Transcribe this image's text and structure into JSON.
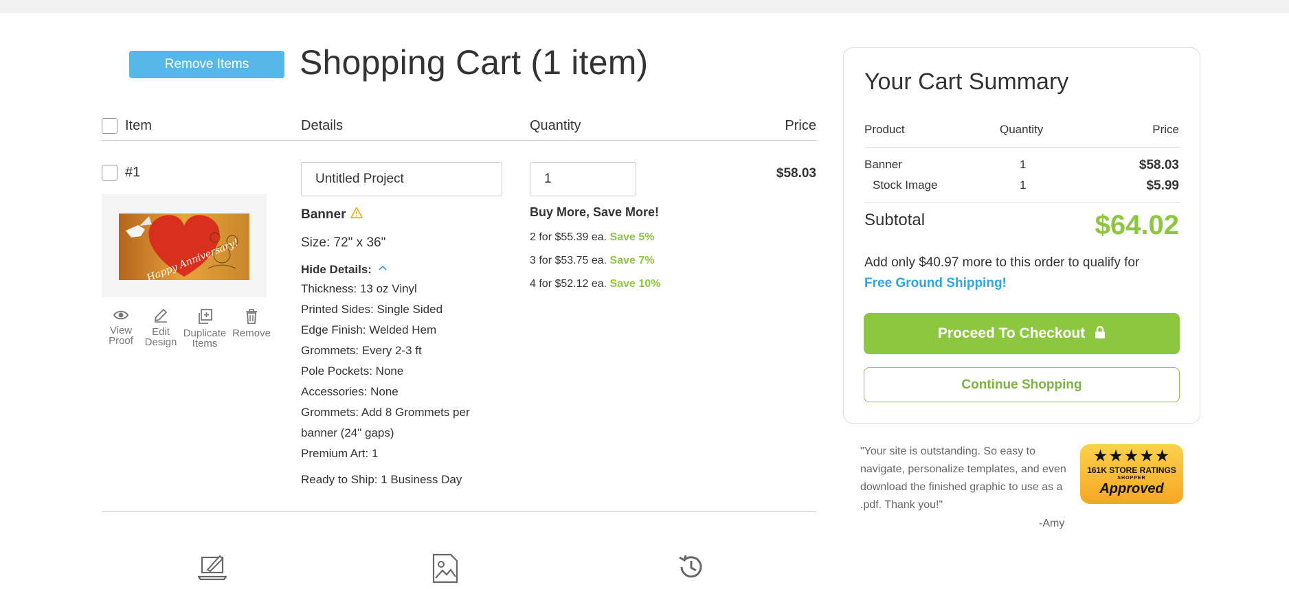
{
  "header": {
    "remove_items_label": "Remove Items",
    "title": "Shopping Cart (1 item)"
  },
  "columns": {
    "item": "Item",
    "details": "Details",
    "quantity": "Quantity",
    "price": "Price"
  },
  "cart_item": {
    "number": "#1",
    "thumbnail_text": "Happy Anniversary!",
    "actions": [
      {
        "line1": "View",
        "line2": "Proof",
        "icon": "eye-icon"
      },
      {
        "line1": "Edit",
        "line2": "Design",
        "icon": "pencil-icon"
      },
      {
        "line1": "Duplicate",
        "line2": "Items",
        "icon": "duplicate-icon"
      },
      {
        "line1": "Remove",
        "line2": "",
        "icon": "trash-icon"
      }
    ],
    "project_name": "Untitled Project",
    "product": "Banner",
    "size": "Size: 72\" x 36\"",
    "hide_details_label": "Hide Details:",
    "details": [
      "Thickness: 13 oz Vinyl",
      "Printed Sides: Single Sided",
      "Edge Finish: Welded Hem",
      "Grommets: Every 2-3 ft",
      "Pole Pockets: None",
      "Accessories: None",
      "Grommets: Add 8 Grommets per",
      "banner (24\" gaps)",
      "Premium Art: 1"
    ],
    "ready_to_ship": "Ready to Ship: 1 Business Day",
    "quantity": "1",
    "buy_more_title": "Buy More, Save More!",
    "tiers": [
      {
        "text": "2 for $55.39 ea.",
        "save": "Save 5%"
      },
      {
        "text": "3 for $53.75 ea.",
        "save": "Save 7%"
      },
      {
        "text": "4 for $52.12 ea.",
        "save": "Save 10%"
      }
    ],
    "price": "$58.03"
  },
  "summary": {
    "title": "Your Cart Summary",
    "head_product": "Product",
    "head_quantity": "Quantity",
    "head_price": "Price",
    "rows": [
      {
        "product": "Banner",
        "quantity": "1",
        "price": "$58.03"
      },
      {
        "product": "Stock Image",
        "quantity": "1",
        "price": "$5.99"
      }
    ],
    "subtotal_label": "Subtotal",
    "subtotal_value": "$64.02",
    "shipping_message": "Add only $40.97 more to this order to qualify for",
    "shipping_link": "Free Ground Shipping!",
    "checkout_label": "Proceed To Checkout",
    "continue_label": "Continue Shopping"
  },
  "testimonial": {
    "quote": "\"Your site is outstanding. So easy to navigate, personalize templates, and even download the finished graphic to use as a .pdf. Thank you!\"",
    "author": "-Amy"
  },
  "badge": {
    "stars": "★★★★★",
    "ratings": "161K STORE RATINGS",
    "shopper": "SHOPPER",
    "approved": "Approved"
  },
  "colors": {
    "accent_green": "#8dc63f",
    "accent_blue": "#55b8e8",
    "link_blue": "#2ea7e0"
  }
}
